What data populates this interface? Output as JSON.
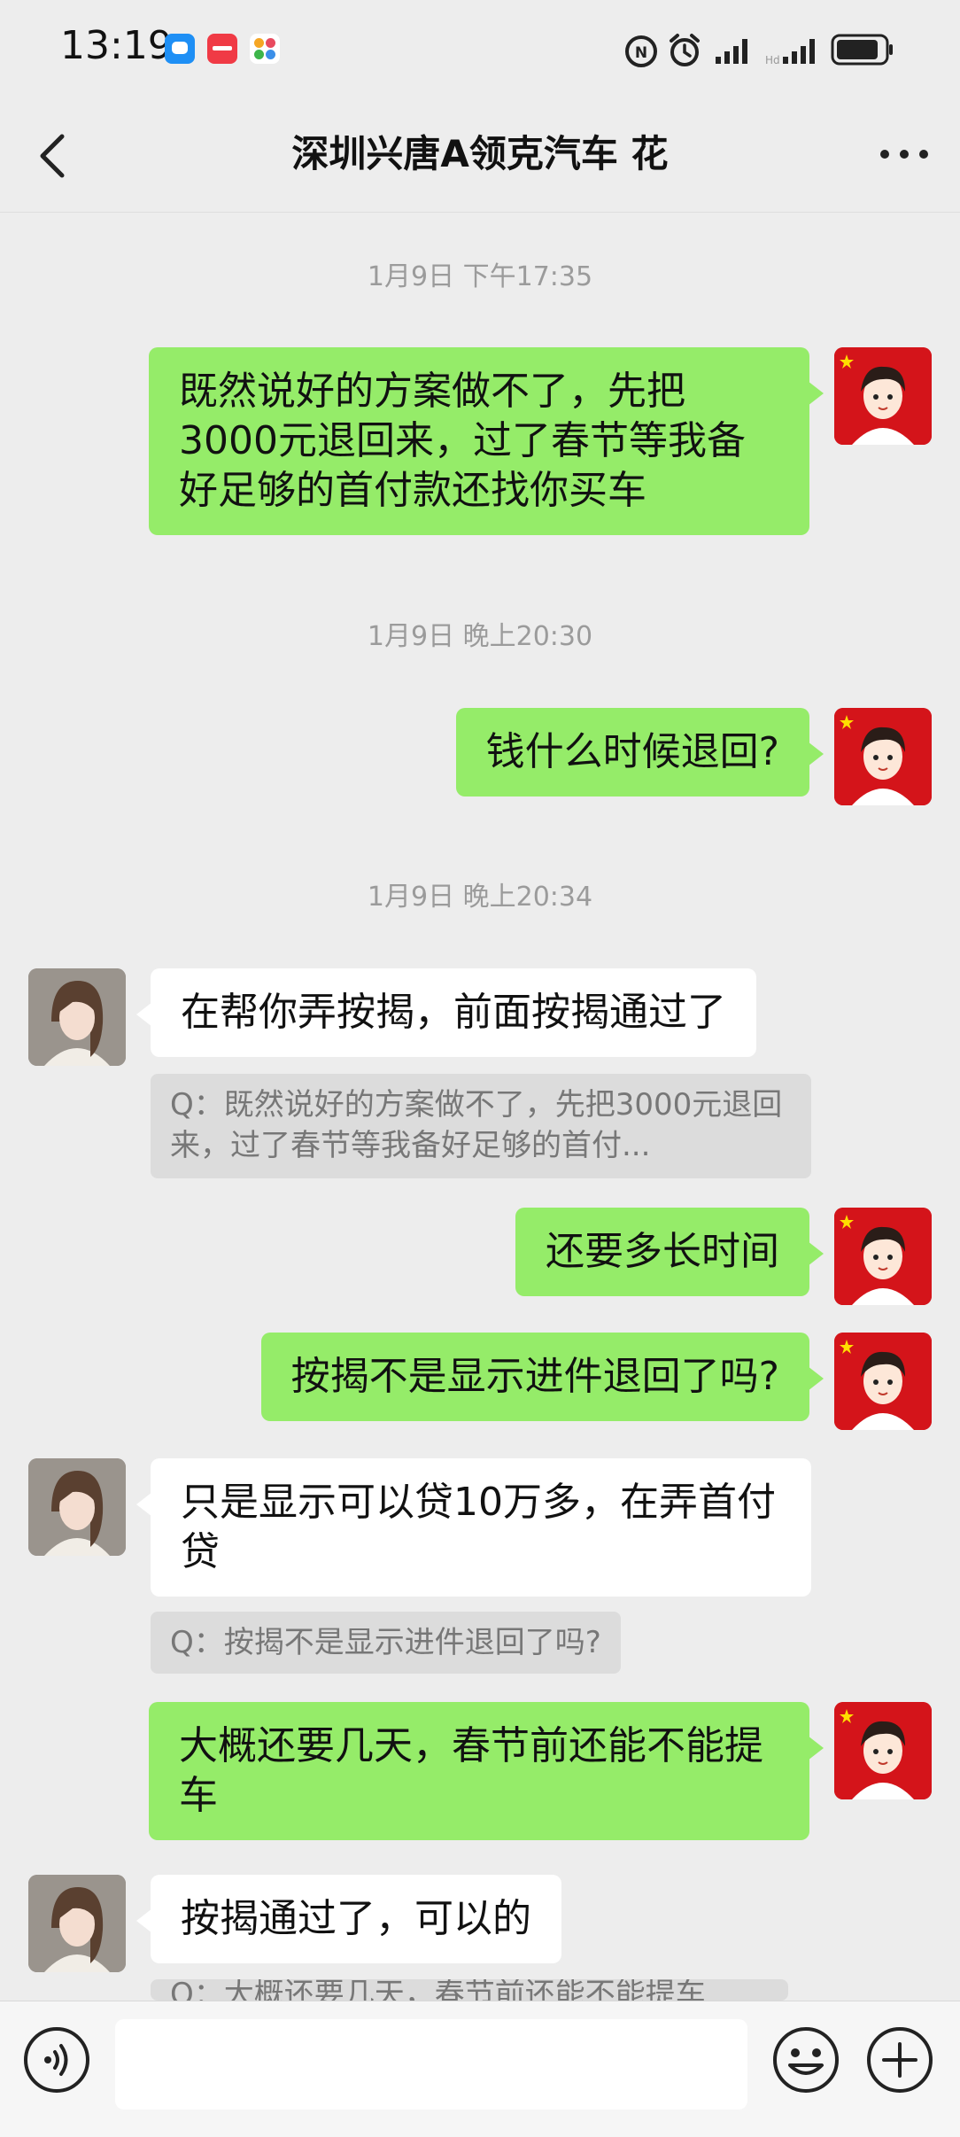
{
  "status_bar": {
    "time": "13:19",
    "icons": [
      "messages-app-icon",
      "app-store-icon",
      "flower-app-icon",
      "nfc-icon",
      "alarm-icon",
      "signal-icon",
      "signal-icon",
      "battery-icon"
    ]
  },
  "header": {
    "title": "深圳兴唐A领克汽车 花",
    "back_icon": "back-arrow-icon",
    "more_icon": "more-dots-icon"
  },
  "messages": [
    {
      "type": "time",
      "text": "1月9日 下午17:35"
    },
    {
      "type": "sent",
      "text": "既然说好的方案做不了，先把 3000元退回来，过了春节等我备好足够的首付款还找你买车"
    },
    {
      "type": "time",
      "text": "1月9日 晚上20:30"
    },
    {
      "type": "sent",
      "text": "钱什么时候退回?"
    },
    {
      "type": "time",
      "text": "1月9日 晚上20:34"
    },
    {
      "type": "received",
      "text": "在帮你弄按揭，前面按揭通过了",
      "quote": "Q：既然说好的方案做不了，先把3000元退回来，过了春节等我备好足够的首付..."
    },
    {
      "type": "sent",
      "text": "还要多长时间"
    },
    {
      "type": "sent",
      "text": "按揭不是显示进件退回了吗?"
    },
    {
      "type": "received",
      "text": "只是显示可以贷10万多，在弄首付贷",
      "quote": "Q：按揭不是显示进件退回了吗?"
    },
    {
      "type": "sent",
      "text": "大概还要几天，春节前还能不能提车"
    },
    {
      "type": "received",
      "text": "按揭通过了，可以的",
      "quote": "Q：大概还要几天，春节前还能不能提车"
    }
  ],
  "input_bar": {
    "voice_icon": "voice-icon",
    "input_value": "",
    "emoji_icon": "emoji-icon",
    "plus_icon": "plus-icon"
  },
  "colors": {
    "background": "#ededed",
    "sent_bubble": "#95ec69",
    "received_bubble": "#ffffff",
    "quote_bg": "#dcdcdc",
    "timestamp": "#9b9b9b"
  }
}
